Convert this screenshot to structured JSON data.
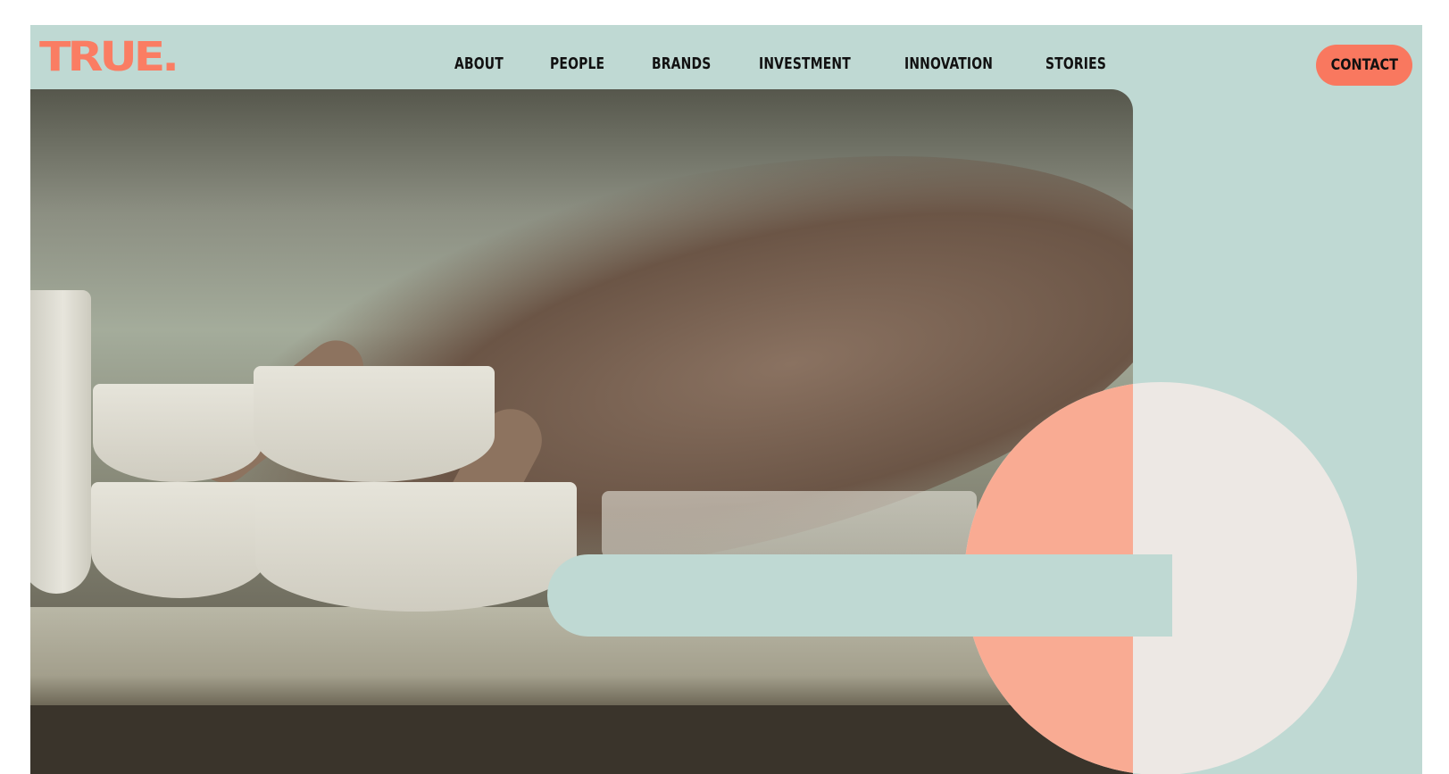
{
  "brand": {
    "logo_text": "TRUE."
  },
  "nav": {
    "items": [
      {
        "label": "ABOUT"
      },
      {
        "label": "PEOPLE"
      },
      {
        "label": "BRANDS"
      },
      {
        "label": "INVESTMENT"
      },
      {
        "label": "INNOVATION"
      },
      {
        "label": "STORIES"
      }
    ]
  },
  "header": {
    "contact_label": "CONTACT"
  },
  "colors": {
    "brand_coral": "#f9785f",
    "mint_background": "#bfd9d3",
    "peach": "#f9ab93",
    "cream": "#ede8e4"
  }
}
